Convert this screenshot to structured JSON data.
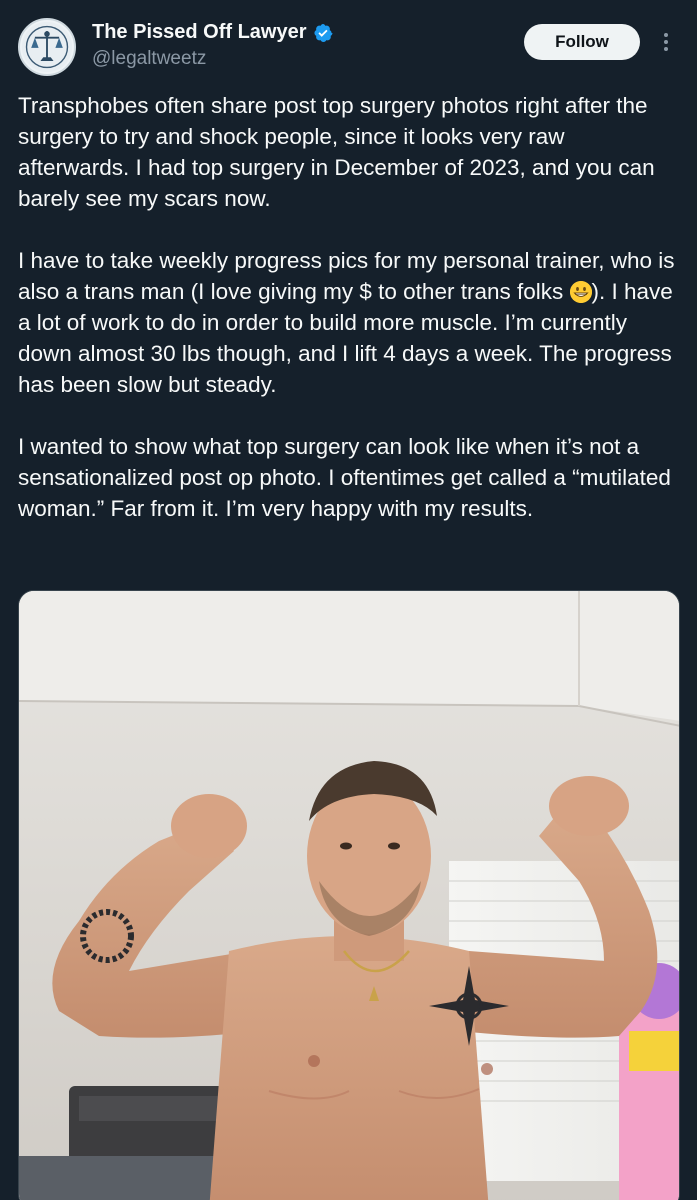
{
  "author": {
    "display_name": "The Pissed Off Lawyer",
    "handle": "@legaltweetz",
    "verified": true,
    "avatar_icon": "justice-scales-avatar"
  },
  "actions": {
    "follow_label": "Follow",
    "more_icon": "more-options-icon"
  },
  "tweet": {
    "paragraph_1": "Transphobes often share post top surgery photos right after the surgery to try and shock people, since it looks very raw afterwards. I had top surgery in December of 2023, and you can barely see my scars now.",
    "paragraph_2_before_emoji": "I have to take weekly progress pics for my personal trainer, who is also a trans man (I love giving my $ to other trans folks ",
    "paragraph_2_emoji": "grinning-face-emoji",
    "paragraph_2_after_emoji": "). I have a lot of work to do in order to build more muscle. I’m currently down almost 30 lbs though, and I lift 4 days a week. The progress has been slow but steady.",
    "paragraph_3": "I wanted to show what top surgery can look like when it’s not a sensationalized post op photo. I oftentimes get called a “mutilated woman.” Far from it. I’m very happy with my results."
  },
  "media": {
    "type": "photo"
  },
  "colors": {
    "background": "#15202b",
    "text": "#f7f9f9",
    "secondary_text": "#8b98a5",
    "verified_badge": "#1d9bf0",
    "follow_button_bg": "#eff3f4"
  }
}
